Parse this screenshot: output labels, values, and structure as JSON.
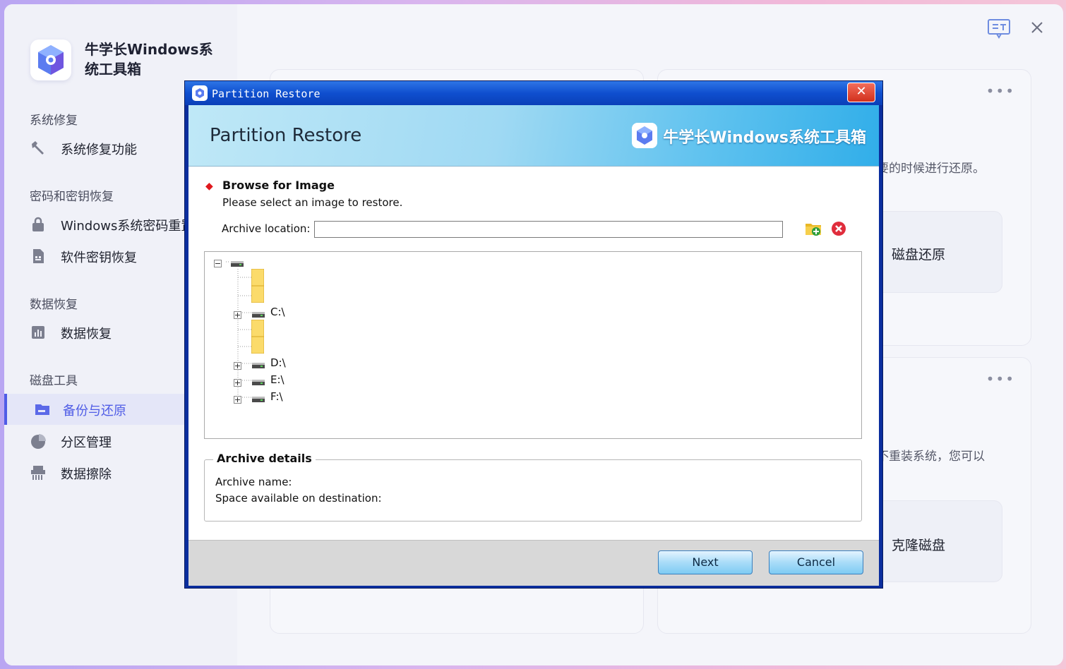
{
  "app": {
    "title": "牛学长Windows系统工具箱",
    "accent_color": "#4f5ce6"
  },
  "sidebar": {
    "sections": [
      {
        "title": "系统修复",
        "items": [
          {
            "label": "系统修复功能",
            "icon": "wrench-icon"
          }
        ]
      },
      {
        "title": "密码和密钥恢复",
        "items": [
          {
            "label": "Windows系统密码重置",
            "icon": "lock-icon"
          },
          {
            "label": "软件密钥恢复",
            "icon": "document-key-icon"
          }
        ]
      },
      {
        "title": "数据恢复",
        "items": [
          {
            "label": "数据恢复",
            "icon": "chart-box-icon"
          }
        ]
      },
      {
        "title": "磁盘工具",
        "items": [
          {
            "label": "备份与还原",
            "icon": "folder-icon",
            "active": true
          },
          {
            "label": "分区管理",
            "icon": "pie-chart-icon"
          },
          {
            "label": "数据擦除",
            "icon": "shredder-icon"
          }
        ]
      }
    ]
  },
  "main": {
    "card1": {
      "text": "要的时候进行还原。",
      "option": "磁盘还原"
    },
    "card2": {
      "text": "不重装系统，您可以",
      "option": "克隆磁盘"
    }
  },
  "dialog": {
    "window_title": "Partition Restore",
    "banner_title": "Partition Restore",
    "brand": "牛学长Windows系统工具箱",
    "step_title": "Browse for Image",
    "step_subtitle": "Please select an image to restore.",
    "archive_location_label": "Archive location:",
    "archive_location_value": "",
    "tree": {
      "drives": [
        "C:\\",
        "D:\\",
        "E:\\",
        "F:\\"
      ]
    },
    "details": {
      "legend": "Archive details",
      "archive_name_label": "Archive name:",
      "space_label": "Space available on destination:"
    },
    "buttons": {
      "next": "Next",
      "cancel": "Cancel"
    }
  }
}
